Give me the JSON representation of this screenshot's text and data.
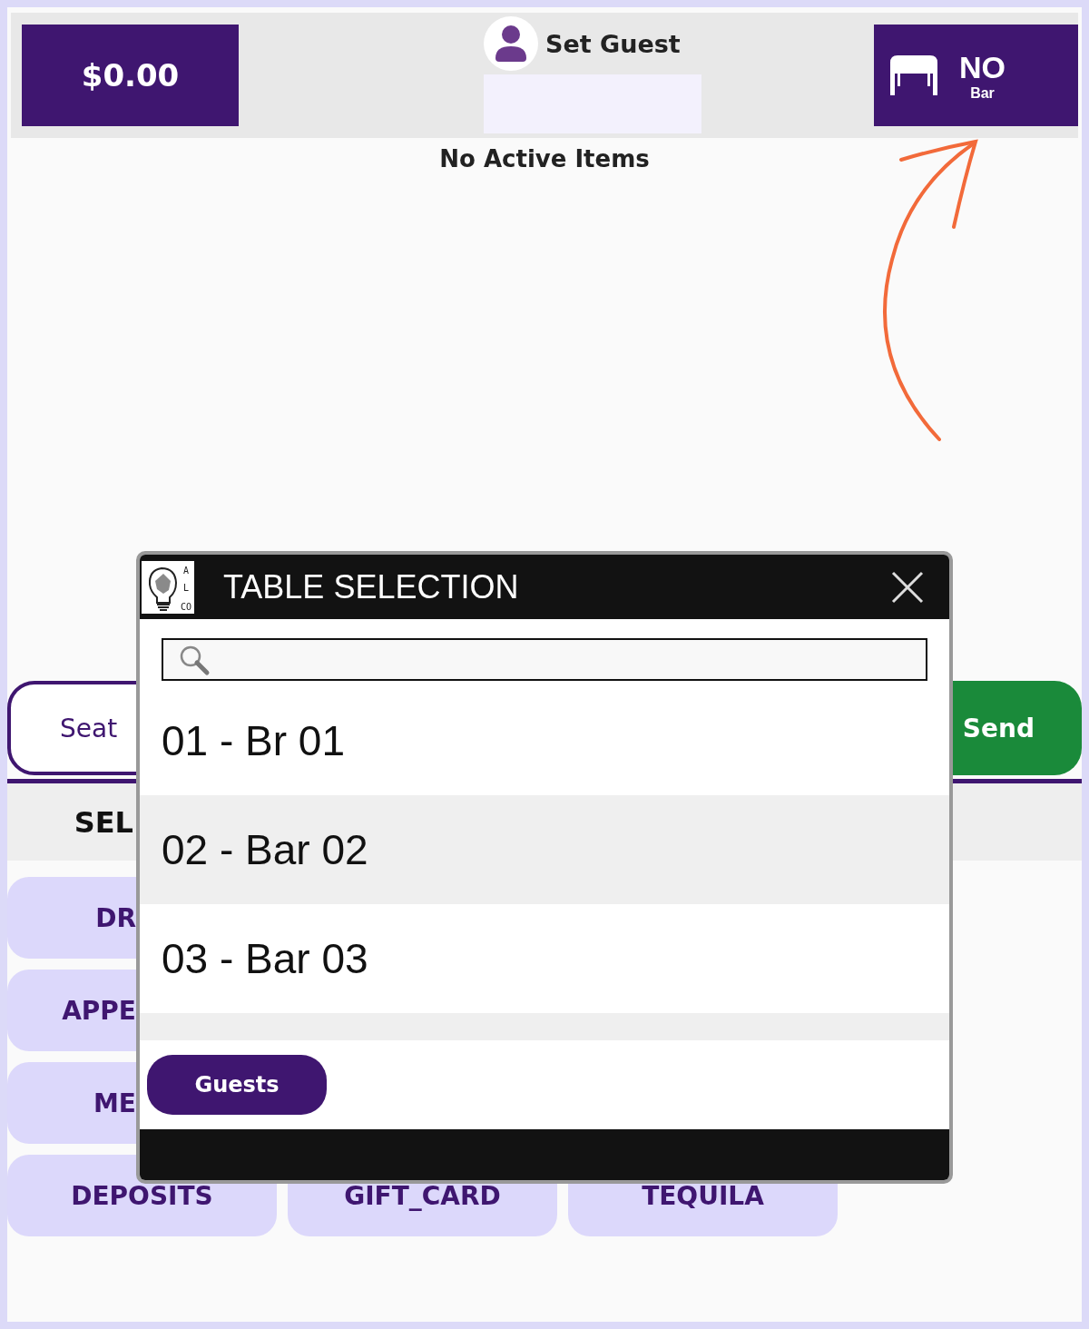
{
  "header": {
    "total": "$0.00",
    "guest_label": "Set Guest",
    "table_number": "NO",
    "table_area": "Bar"
  },
  "order": {
    "empty_message": "No Active Items"
  },
  "actions": {
    "seat_button": "Seat",
    "send_button": "Send"
  },
  "category_heading": "SEL",
  "categories": [
    {
      "label": "DR",
      "kind": "partial"
    },
    {
      "label": "APPE",
      "kind": "partial"
    },
    {
      "label": "ME",
      "kind": "partial"
    },
    {
      "label": "DEPOSITS",
      "kind": "full"
    },
    {
      "label": "GIFT_CARD",
      "kind": "full"
    },
    {
      "label": "TEQUILA",
      "kind": "full"
    }
  ],
  "dialog": {
    "title": "TABLE SELECTION",
    "logo_letters": [
      "A",
      "L",
      "CO"
    ],
    "tables": [
      {
        "label": "01 - Br 01",
        "shaded": false
      },
      {
        "label": "02 - Bar 02",
        "shaded": true
      },
      {
        "label": "03 - Bar 03",
        "shaded": false
      }
    ],
    "guests_button": "Guests"
  }
}
